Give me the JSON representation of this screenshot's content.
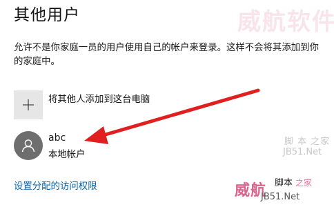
{
  "page": {
    "title": "其他用户",
    "description": "允许不是你家庭一员的用户使用自己的帐户来登录。这样不会将其添加到你的家庭中。"
  },
  "add_user": {
    "label": "将其他人添加到这台电脑",
    "icon": "plus-icon"
  },
  "user": {
    "name": "abc",
    "type": "本地帐户",
    "icon": "person-icon"
  },
  "links": {
    "assigned_access": "设置分配的访问权限"
  },
  "annotation": {
    "arrow_color": "#e02020"
  },
  "watermarks": {
    "top_right": "威航软件网",
    "small_top": "脚 本 之家",
    "small_mid": "JB51.Net",
    "bottom_cn": "威航",
    "bottom_mid": "脚本",
    "bottom_pink": "之家",
    "bottom_net": "JB51.Net"
  },
  "colors": {
    "link": "#0063b1",
    "tile_bg": "#e6e6e6",
    "avatar_bg": "#6e6e6e",
    "arrow": "#e02020"
  }
}
